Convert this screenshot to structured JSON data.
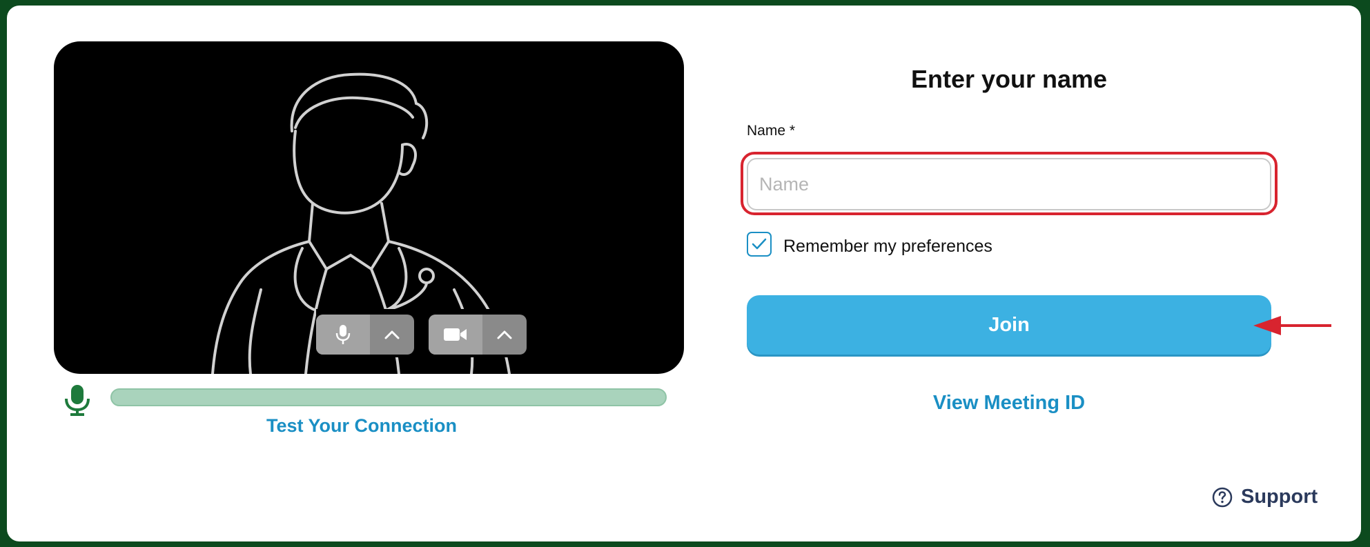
{
  "preview": {
    "mic_icon": "microphone-icon",
    "mic_menu_icon": "chevron-up-icon",
    "camera_icon": "video-camera-icon",
    "camera_menu_icon": "chevron-up-icon",
    "mic_level_icon": "microphone-icon",
    "mic_level_fraction": 0,
    "test_connection_label": "Test Your Connection"
  },
  "form": {
    "title": "Enter your name",
    "name_label": "Name *",
    "name_placeholder": "Name",
    "name_value": "",
    "remember_label": "Remember my preferences",
    "remember_checked": true,
    "join_label": "Join",
    "view_meeting_label": "View Meeting ID"
  },
  "support": {
    "icon": "question-circle-icon",
    "label": "Support"
  },
  "colors": {
    "frame": "#0c4a1e",
    "accent": "#1a8fc4",
    "join_button": "#3cb1e2",
    "highlight": "#d8242f",
    "mic_green": "#1e7a3c",
    "level_bar": "#a9d3bc"
  }
}
